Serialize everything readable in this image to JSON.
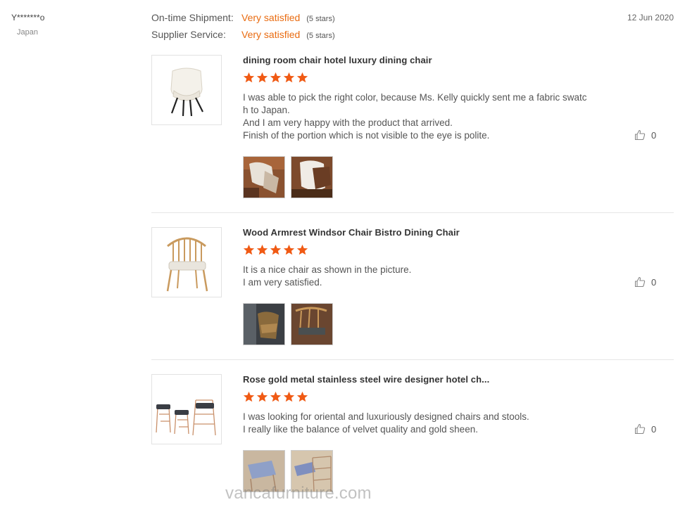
{
  "reviewer": {
    "name": "Y*******o",
    "country": "Japan"
  },
  "ratings": [
    {
      "label": "On-time Shipment:",
      "value": "Very satisfied",
      "stars": "(5 stars)"
    },
    {
      "label": "Supplier Service:",
      "value": "Very satisfied",
      "stars": "(5 stars)"
    }
  ],
  "date": "12 Jun 2020",
  "colors": {
    "accent": "#e96b10",
    "star": "#f05a14",
    "divider": "#e6e6e6"
  },
  "reviews": [
    {
      "product_title": "dining room chair hotel luxury dining chair",
      "rating": 5,
      "comment_lines": [
        "I was able to pick the right color, because Ms. Kelly quickly sent me a fabric swatc",
        "h to Japan.",
        "And I am very happy with the product that arrived.",
        "Finish of the portion which is not visible to the eye is polite."
      ],
      "likes": "0",
      "photo_count": 2
    },
    {
      "product_title": "Wood Armrest Windsor Chair Bistro Dining Chair",
      "rating": 5,
      "comment_lines": [
        "It is a nice chair as shown in the picture.",
        "I am very satisfied."
      ],
      "likes": "0",
      "photo_count": 2
    },
    {
      "product_title": "Rose gold metal stainless steel wire designer hotel ch...",
      "rating": 5,
      "comment_lines": [
        "I was looking for oriental and luxuriously designed chairs and stools.",
        "I really like the balance of velvet quality and gold sheen."
      ],
      "likes": "0",
      "photo_count": 2
    }
  ],
  "icons": {
    "like": "thumbs-up-icon",
    "star": "star-icon"
  },
  "watermark": "vancafurniture.com"
}
